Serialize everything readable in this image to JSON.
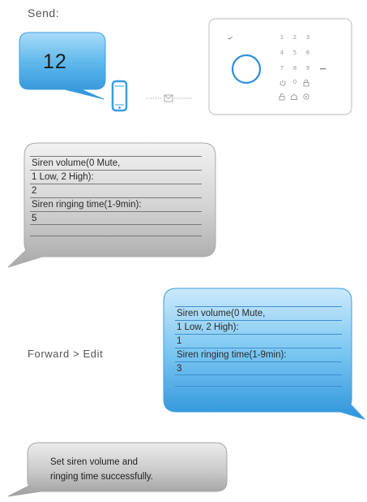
{
  "header": {
    "send_label": "Send:",
    "forward_label": "Forward > Edit"
  },
  "code_bubble": {
    "value": "12"
  },
  "phone": {
    "name": "phone-icon",
    "envelope": "envelope-icon"
  },
  "panel": {
    "keys": [
      "1",
      "2",
      "3",
      "4",
      "5",
      "6",
      "7",
      "8",
      "9",
      "0"
    ],
    "icons": [
      "signal-icon",
      "power-icon",
      "lock-icon",
      "unlock-icon",
      "home-icon",
      "sos-icon",
      "house-icon"
    ]
  },
  "reply_bubble_gray": {
    "lines": [
      "Siren volume(0 Mute,",
      "1 Low, 2 High):",
      "2",
      "Siren ringing time(1-9min):",
      "5"
    ]
  },
  "edit_bubble_blue": {
    "lines": [
      "Siren volume(0 Mute,",
      "1 Low, 2 High):",
      "1",
      "Siren ringing time(1-9min):",
      "3"
    ]
  },
  "result_bubble": {
    "line1": "Set siren volume and",
    "line2": "ringing time successfully."
  }
}
